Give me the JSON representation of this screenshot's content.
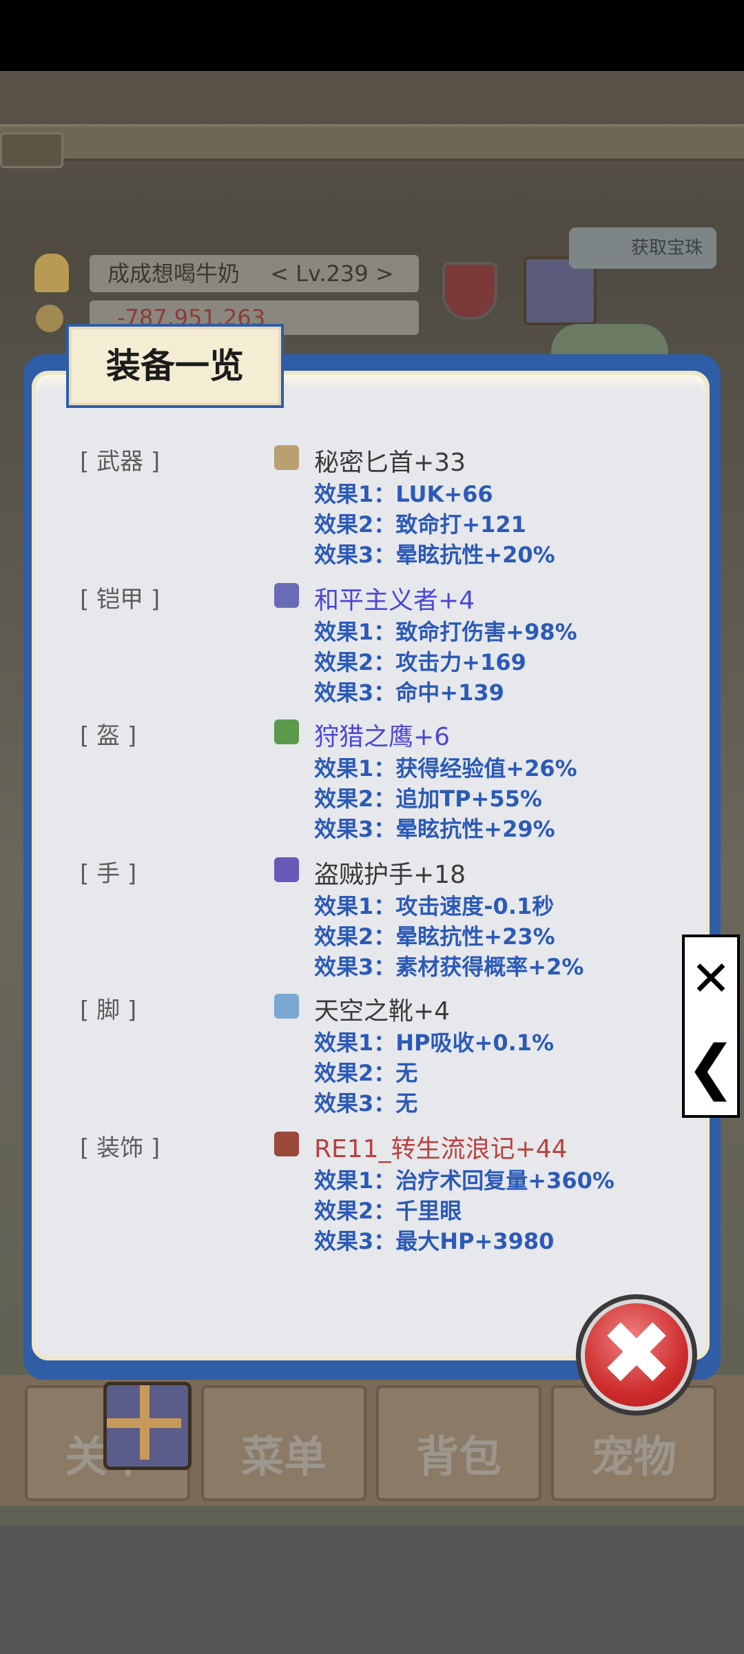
{
  "background": {
    "player_name": "成成想喝牛奶",
    "player_level": "< Lv.239 >",
    "money": "-787,951,263",
    "top_button": "获取宝珠",
    "nav": [
      "关卡",
      "菜单",
      "背包",
      "宠物"
    ]
  },
  "modal": {
    "title": "装备一览",
    "slots": [
      {
        "slot": "[ 武器 ]",
        "name": "秘密匕首+33",
        "color": "#3a3a3a",
        "icon": "dagger-icon",
        "effects": [
          "效果1：LUK+66",
          "效果2：致命打+121",
          "效果3：晕眩抗性+20%"
        ]
      },
      {
        "slot": "[ 铠甲 ]",
        "name": "和平主义者+4",
        "color": "#4a47d6",
        "icon": "armor-icon",
        "effects": [
          "效果1：致命打伤害+98%",
          "效果2：攻击力+169",
          "效果3：命中+139"
        ]
      },
      {
        "slot": "[ 盔 ]",
        "name": "狩猎之鹰+6",
        "color": "#4a47d6",
        "icon": "helmet-icon",
        "effects": [
          "效果1：获得经验值+26%",
          "效果2：追加TP+55%",
          "效果3：晕眩抗性+29%"
        ]
      },
      {
        "slot": "[ 手 ]",
        "name": "盗贼护手+18",
        "color": "#3a3a3a",
        "icon": "glove-icon",
        "effects": [
          "效果1：攻击速度-0.1秒",
          "效果2：晕眩抗性+23%",
          "效果3：素材获得概率+2%"
        ]
      },
      {
        "slot": "[ 脚 ]",
        "name": "天空之靴+4",
        "color": "#3a3a3a",
        "icon": "boot-icon",
        "effects": [
          "效果1：HP吸收+0.1%",
          "效果2：无",
          "效果3：无"
        ]
      },
      {
        "slot": "[ 装饰 ]",
        "name": "RE11_转生流浪记+44",
        "color": "#b9413e",
        "icon": "book-icon",
        "effects": [
          "效果1：治疗术回复量+360%",
          "效果2：千里眼",
          "效果3：最大HP+3980"
        ]
      }
    ]
  },
  "side_buttons": {
    "close": "✕",
    "back": "❮"
  },
  "close_button": "✖"
}
